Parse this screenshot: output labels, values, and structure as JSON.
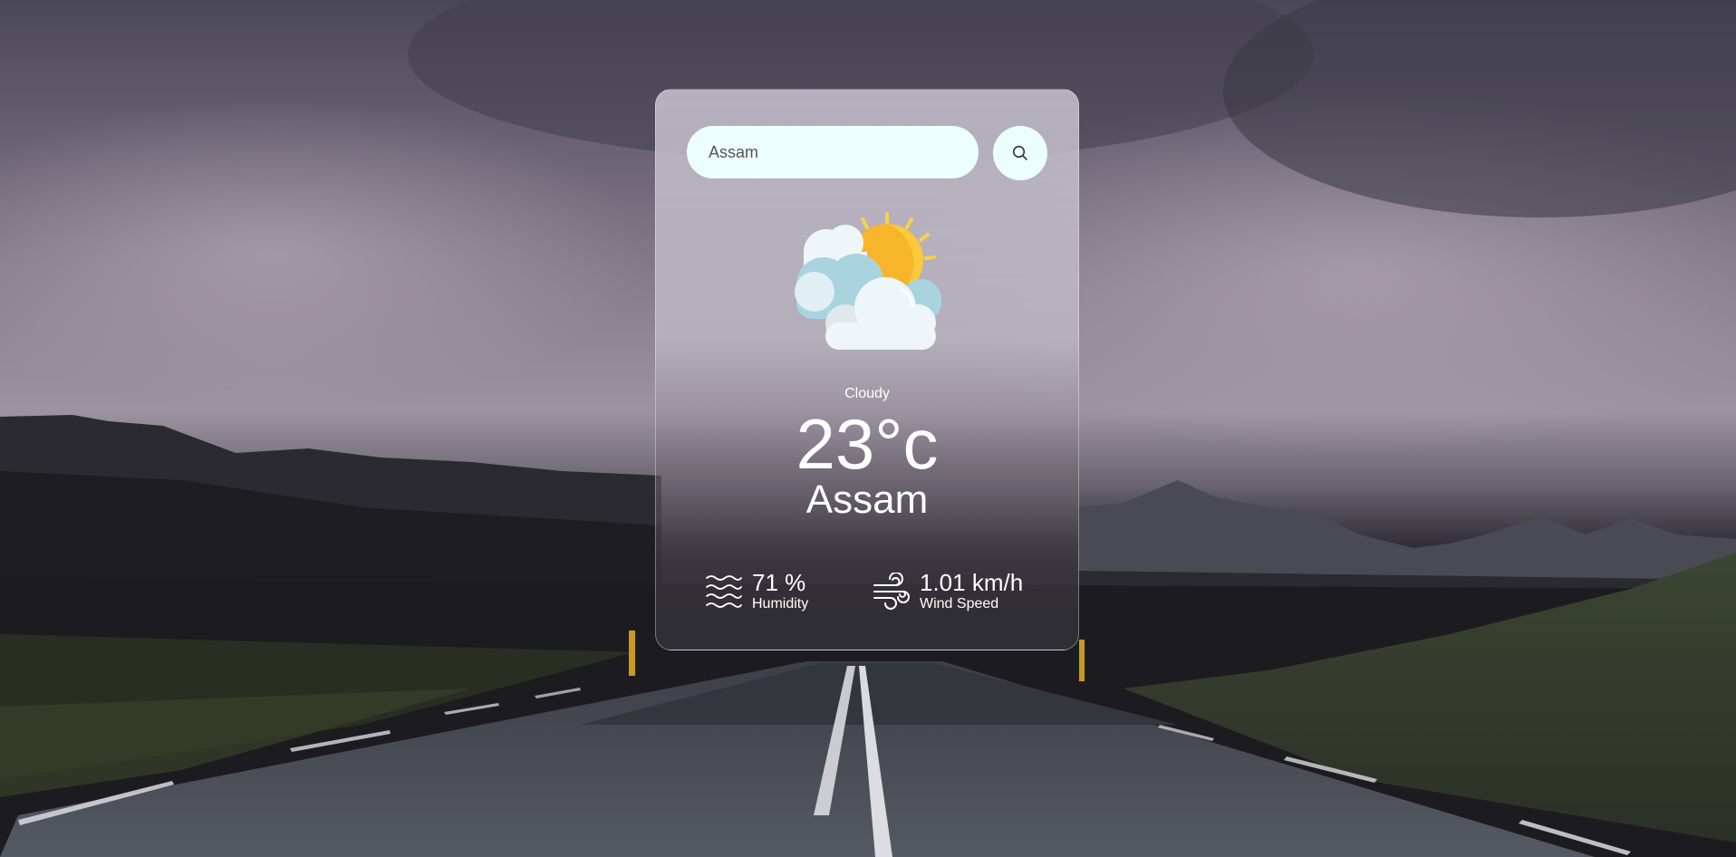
{
  "search": {
    "value": "Assam",
    "button_icon": "search-icon"
  },
  "weather": {
    "icon": "partly-cloudy-sun-icon",
    "condition": "Cloudy",
    "temperature": "23°c",
    "city": "Assam"
  },
  "stats": {
    "humidity": {
      "icon": "humidity-waves-icon",
      "value": "71 %",
      "label": "Humidity"
    },
    "wind": {
      "icon": "wind-icon",
      "value": "1.01 km/h",
      "label": "Wind Speed"
    }
  },
  "colors": {
    "input_bg": "#ebfffb",
    "text": "#ffffff",
    "sun": "#f7b52c",
    "cloud": "#e8f1f5",
    "cloud_shade": "#a9d3df"
  }
}
